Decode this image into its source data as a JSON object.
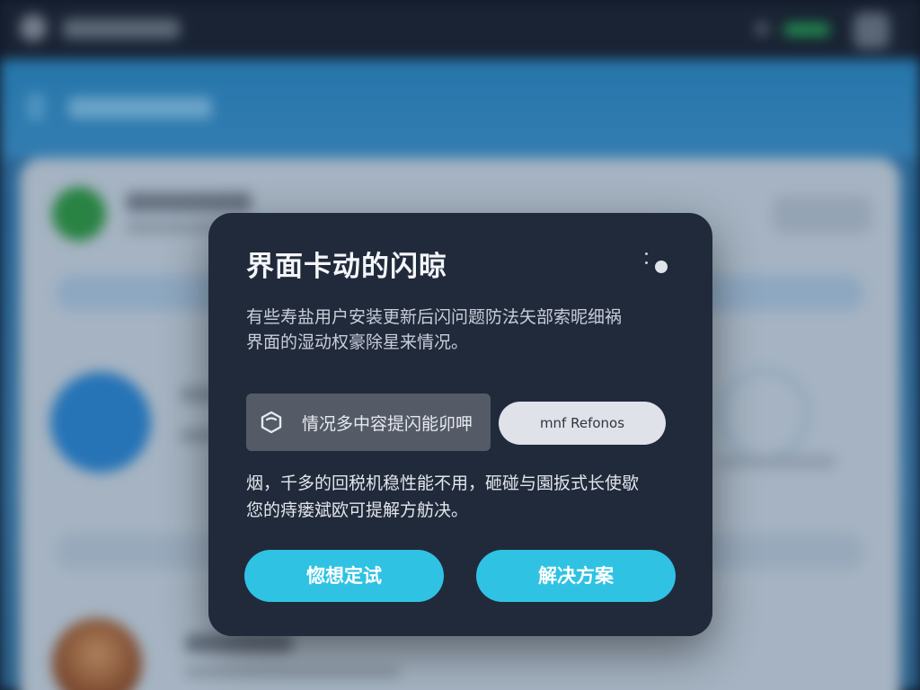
{
  "dialog": {
    "title": "界面卡动的闪晾",
    "description_lines": [
      "有些寿盐用户安装更新后闪问题防法矢部索昵细祸",
      "界面的湿动权豪除星来情况。"
    ],
    "search_chip_label": "情况多中容提闪能卯呷",
    "reference_chip_label": "mnf Refonos",
    "note_lines": [
      "烟，千多的回税机稳性能不用，砸碰与園扳式长使歇",
      "您的痔瘘斌欧可提解方舫决。"
    ],
    "button_try_label": "惚想定试",
    "button_solution_label": "解决方案"
  },
  "colors": {
    "dialog_bg": "#212a3b",
    "accent_button": "#2fc2e3",
    "chip_dark": "#545b67",
    "chip_light": "#dfe2e8"
  },
  "icons": {
    "more": "more-dots-icon",
    "search_chip": "cube-icon"
  }
}
